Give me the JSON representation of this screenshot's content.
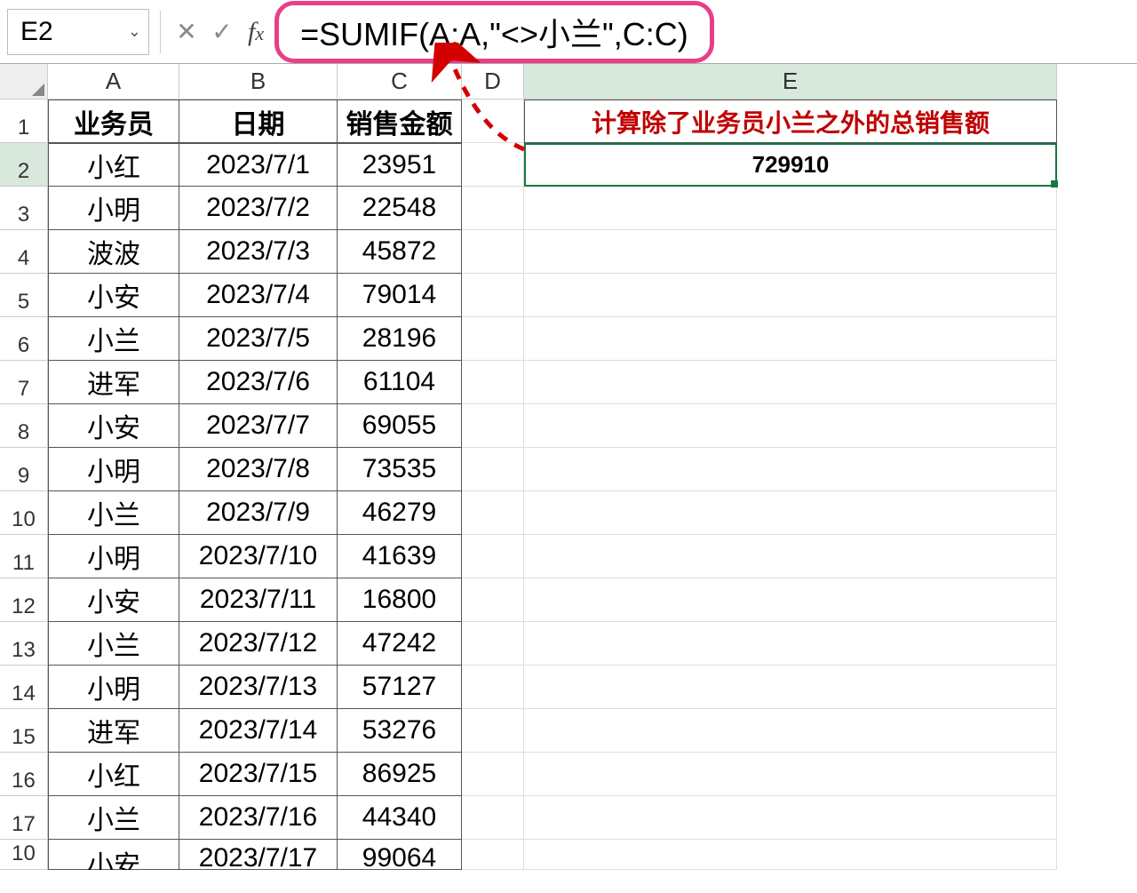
{
  "nameBox": "E2",
  "formula": "=SUMIF(A:A,\"<>小兰\",C:C)",
  "columns": [
    "A",
    "B",
    "C",
    "D",
    "E"
  ],
  "headers": {
    "A": "业务员",
    "B": "日期",
    "C": "销售金额"
  },
  "eHeader": "计算除了业务员小兰之外的总销售额",
  "eValue": "729910",
  "rows": [
    {
      "n": 2,
      "a": "小红",
      "b": "2023/7/1",
      "c": "23951"
    },
    {
      "n": 3,
      "a": "小明",
      "b": "2023/7/2",
      "c": "22548"
    },
    {
      "n": 4,
      "a": "波波",
      "b": "2023/7/3",
      "c": "45872"
    },
    {
      "n": 5,
      "a": "小安",
      "b": "2023/7/4",
      "c": "79014"
    },
    {
      "n": 6,
      "a": "小兰",
      "b": "2023/7/5",
      "c": "28196"
    },
    {
      "n": 7,
      "a": "进军",
      "b": "2023/7/6",
      "c": "61104"
    },
    {
      "n": 8,
      "a": "小安",
      "b": "2023/7/7",
      "c": "69055"
    },
    {
      "n": 9,
      "a": "小明",
      "b": "2023/7/8",
      "c": "73535"
    },
    {
      "n": 10,
      "a": "小兰",
      "b": "2023/7/9",
      "c": "46279"
    },
    {
      "n": 11,
      "a": "小明",
      "b": "2023/7/10",
      "c": "41639"
    },
    {
      "n": 12,
      "a": "小安",
      "b": "2023/7/11",
      "c": "16800"
    },
    {
      "n": 13,
      "a": "小兰",
      "b": "2023/7/12",
      "c": "47242"
    },
    {
      "n": 14,
      "a": "小明",
      "b": "2023/7/13",
      "c": "57127"
    },
    {
      "n": 15,
      "a": "进军",
      "b": "2023/7/14",
      "c": "53276"
    },
    {
      "n": 16,
      "a": "小红",
      "b": "2023/7/15",
      "c": "86925"
    },
    {
      "n": 17,
      "a": "小兰",
      "b": "2023/7/16",
      "c": "44340"
    }
  ],
  "partialRow": {
    "n": "10",
    "a": "小安",
    "b": "2023/7/17",
    "c": "99064",
    "rh": "10"
  },
  "partialRowNum": "10"
}
